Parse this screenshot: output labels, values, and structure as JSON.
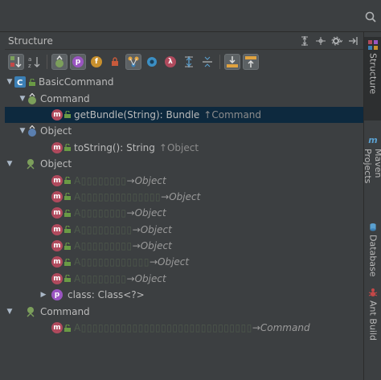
{
  "panel": {
    "title": "Structure"
  },
  "side_tabs": [
    {
      "label": "Structure",
      "icon": "structure-icon",
      "active": true
    },
    {
      "label": "Maven Projects",
      "icon": "maven-icon",
      "active": false
    },
    {
      "label": "Database",
      "icon": "database-icon",
      "active": false
    },
    {
      "label": "Ant Build",
      "icon": "ant-icon",
      "active": false
    }
  ],
  "tree": {
    "root": {
      "label": "BasicCommand"
    },
    "group1": {
      "label": "Command"
    },
    "group1_item": {
      "label": "getBundle(String): Bundle",
      "suffix": "↑Command"
    },
    "group2": {
      "label": "Object"
    },
    "group2_item": {
      "label": "toString(): String",
      "suffix": "↑Object"
    },
    "group3": {
      "label": "Object"
    },
    "group3_items": [
      {
        "obf": "A▯▯▯▯▯▯▯▯",
        "ret": "→Object"
      },
      {
        "obf": "A▯▯▯▯▯▯▯▯▯▯▯▯▯▯",
        "ret": "→Object"
      },
      {
        "obf": "A▯▯▯▯▯▯▯▯",
        "ret": "→Object"
      },
      {
        "obf": "A▯▯▯▯▯▯▯▯▯",
        "ret": "→Object"
      },
      {
        "obf": "A▯▯▯▯▯▯▯▯▯",
        "ret": "→Object"
      },
      {
        "obf": "A▯▯▯▯▯▯▯▯▯▯▯▯",
        "ret": "→Object"
      },
      {
        "obf": "A▯▯▯▯▯▯▯▯",
        "ret": "→Object"
      }
    ],
    "group3_class": {
      "label": "class: Class<?>"
    },
    "group4": {
      "label": "Command"
    },
    "group4_item": {
      "obf": "A▯▯▯▯▯▯▯▯▯▯▯▯▯▯▯▯▯▯▯▯▯▯▯▯▯▯▯▯▯▯",
      "ret": "→Command"
    }
  },
  "colors": {
    "method": "#b04a5d",
    "property": "#9a55c1",
    "class": "#3b7fb5",
    "selected": "#0d293e"
  }
}
